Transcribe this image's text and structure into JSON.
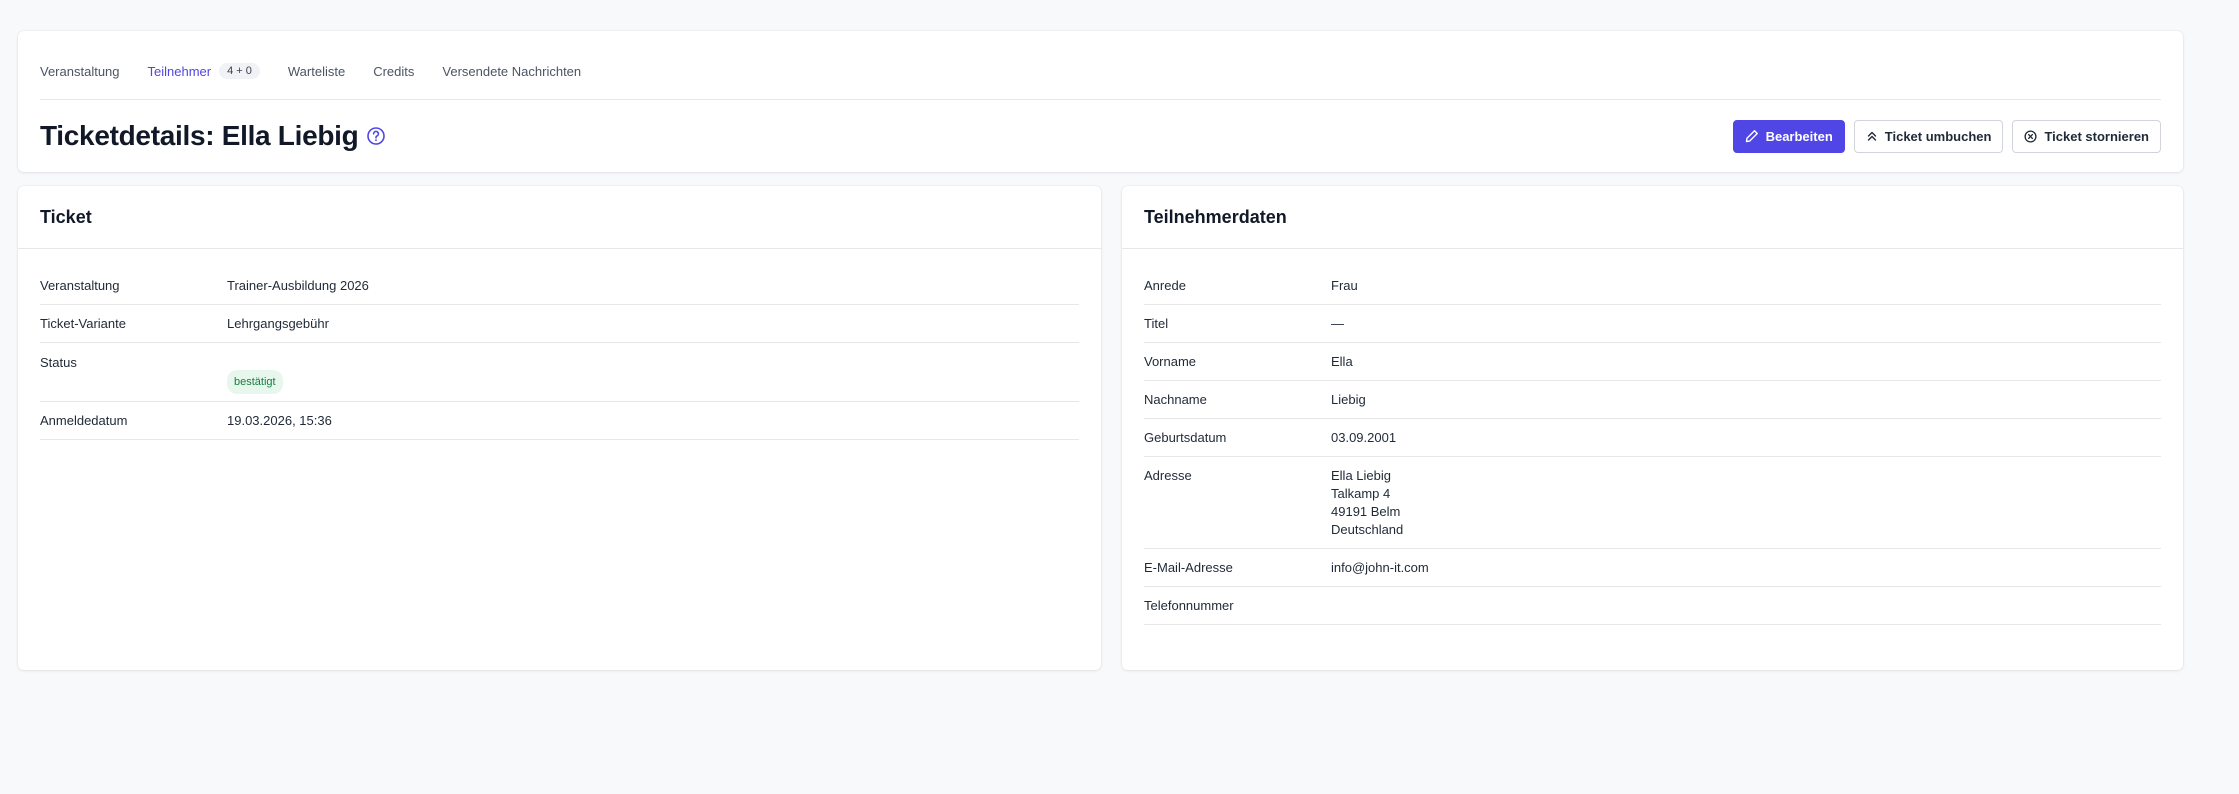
{
  "tabs": [
    {
      "label": "Veranstaltung",
      "active": false
    },
    {
      "label": "Teilnehmer",
      "active": true,
      "badge": "4 + 0"
    },
    {
      "label": "Warteliste",
      "active": false
    },
    {
      "label": "Credits",
      "active": false
    },
    {
      "label": "Versendete Nachrichten",
      "active": false
    }
  ],
  "header": {
    "title": "Ticketdetails: Ella Liebig",
    "help_icon": "question-circle-icon"
  },
  "actions": {
    "edit_label": "Bearbeiten",
    "rebook_label": "Ticket umbuchen",
    "cancel_label": "Ticket stornieren"
  },
  "ticket": {
    "heading": "Ticket",
    "rows": [
      {
        "label": "Veranstaltung",
        "value": "Trainer-Ausbildung 2026"
      },
      {
        "label": "Ticket-Variante",
        "value": "Lehrgangsgebühr"
      },
      {
        "label": "Status",
        "value": "bestätigt"
      },
      {
        "label": "Anmeldedatum",
        "value": "19.03.2026, 15:36"
      }
    ]
  },
  "participant": {
    "heading": "Teilnehmerdaten",
    "rows": [
      {
        "label": "Anrede",
        "value": "Frau"
      },
      {
        "label": "Titel",
        "value": "—"
      },
      {
        "label": "Vorname",
        "value": "Ella"
      },
      {
        "label": "Nachname",
        "value": "Liebig"
      },
      {
        "label": "Geburtsdatum",
        "value": "03.09.2001"
      },
      {
        "label": "Adresse",
        "value": "Ella Liebig\nTalkamp 4\n49191 Belm\nDeutschland"
      },
      {
        "label": "E-Mail-Adresse",
        "value": "info@john-it.com"
      },
      {
        "label": "Telefonnummer",
        "value": ""
      }
    ]
  },
  "colors": {
    "accent": "#4f46e5",
    "status_bg": "#e8f7ee",
    "status_text": "#15803d",
    "page_bg": "#f8f9fb"
  }
}
